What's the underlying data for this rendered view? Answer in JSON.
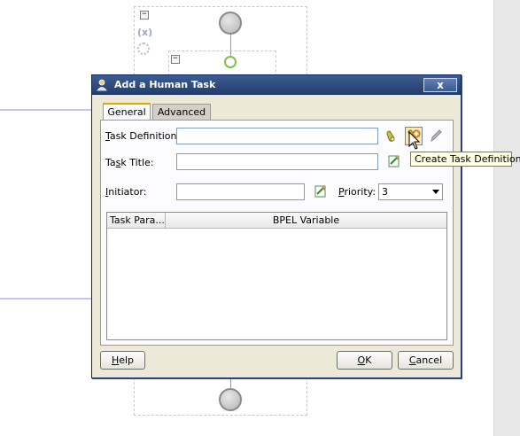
{
  "dialog": {
    "title": "Add a Human Task",
    "close_label": "x",
    "tabs": [
      {
        "label": "General",
        "active": true
      },
      {
        "label": "Advanced",
        "active": false
      }
    ],
    "fields": {
      "task_definition": {
        "label_mnemonic": "T",
        "label_rest": "ask Definition:",
        "value": ""
      },
      "task_title": {
        "label_pre": "Ta",
        "label_mnemonic": "s",
        "label_rest": "k Title:",
        "value": ""
      },
      "initiator": {
        "label_mnemonic": "I",
        "label_rest": "nitiator:",
        "value": ""
      },
      "priority": {
        "label_mnemonic": "P",
        "label_rest": "riority:",
        "value": "3"
      }
    },
    "table": {
      "columns": [
        "Task Para...",
        "BPEL Variable"
      ],
      "rows": []
    },
    "buttons": {
      "help_mnemonic": "H",
      "help_rest": "elp",
      "ok_mnemonic": "O",
      "ok_rest": "K",
      "cancel_mnemonic": "C",
      "cancel_rest": "ancel"
    }
  },
  "tooltip": "Create Task Definition",
  "background": {
    "palette_x": "(x)",
    "collapse_glyph": "−"
  },
  "colors": {
    "titlebar": "#2e4d7f",
    "accent_tab": "#e8a600",
    "tooltip_bg": "#ffffe1",
    "swimlane_line": "#c4c6ee"
  }
}
